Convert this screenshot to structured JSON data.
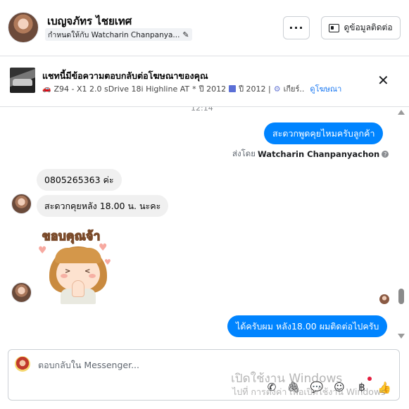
{
  "header": {
    "contact_name": "เบญจภัทร ไชยเทศ",
    "assigned_to": "กำหนดให้กับ Watcharin Chanpanya...",
    "more_label": "···",
    "contact_info_label": "ดูข้อมูลติดต่อ"
  },
  "ad": {
    "title": "แชทนี้มีข้อความตอบกลับต่อโฆษณาของคุณ",
    "model": "Z94 - X1 2.0 sDrive 18i Highline AT",
    "year_1": "ปี 2012",
    "year_2": "ปี 2012 |",
    "gear": "เกียร์..",
    "link": "ดูโฆษณา"
  },
  "conversation": {
    "timestamp": "12:14",
    "messages": [
      {
        "direction": "out",
        "text": "สะดวกพูดคุยไหมครับลูกค้า"
      },
      {
        "direction": "in",
        "text": "0805265363 ค่ะ"
      },
      {
        "direction": "in",
        "text": "สะดวกคุยหลัง 18.00 น. นะคะ"
      },
      {
        "direction": "in",
        "type": "sticker",
        "text": "ขอบคุณจ้า"
      },
      {
        "direction": "out",
        "text": "ได้ครับผม หลัง18.00 ผมติดต่อไปครับ"
      }
    ],
    "sent_by_prefix": "ส่งโดย",
    "sent_by_name": "Watcharin Chanpanyachon"
  },
  "composer": {
    "placeholder": "ตอบกลับใน Messenger...",
    "tools": [
      "phone-icon",
      "attachment-icon",
      "saved-replies-icon",
      "emoji-icon",
      "payment-icon",
      "like-icon"
    ],
    "currency_symbol": "฿"
  },
  "watermark": {
    "line1": "เปิดใช้งาน Windows",
    "line2": "ไปที่ การตั้งค่า เพื่อเปิดใช้งาน Windows"
  },
  "colors": {
    "outgoing_bubble": "#0084ff",
    "incoming_bubble": "#f0f0f0",
    "link": "#1877f2"
  }
}
